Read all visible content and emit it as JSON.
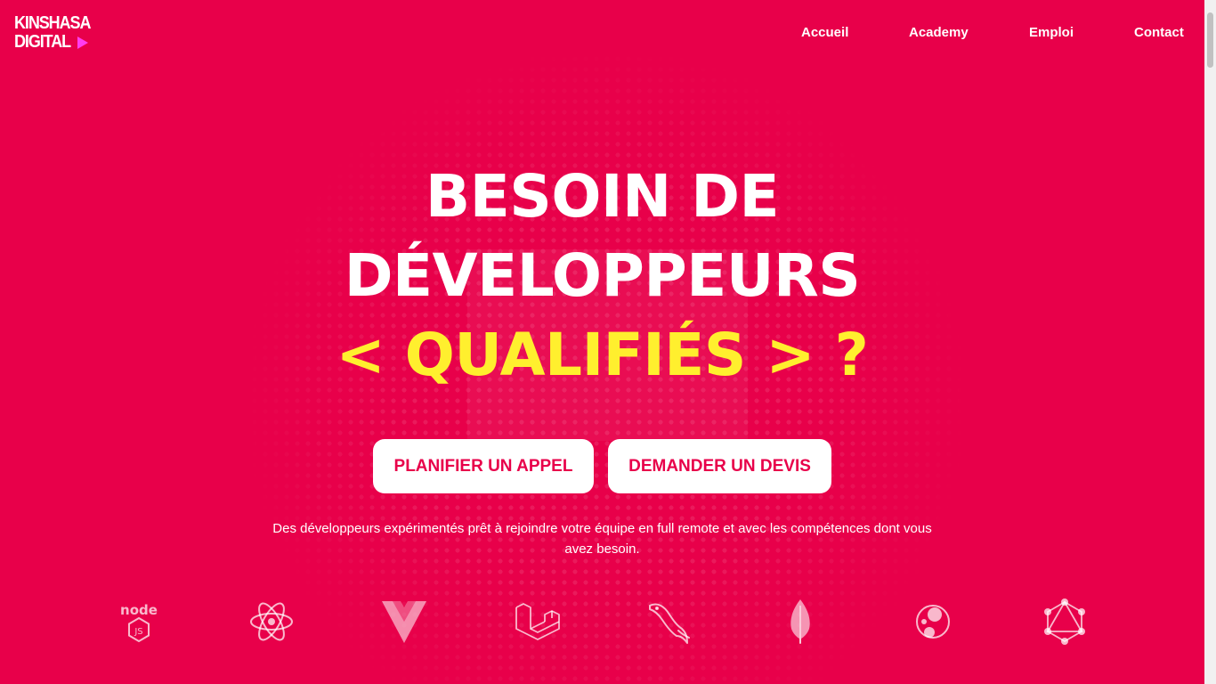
{
  "logo": {
    "line1": "KINSHASA",
    "line2": "DIGITAL"
  },
  "nav": [
    {
      "label": "Accueil"
    },
    {
      "label": "Academy"
    },
    {
      "label": "Emploi"
    },
    {
      "label": "Contact"
    }
  ],
  "hero": {
    "line1": "BESOIN DE",
    "line2": "DÉVELOPPEURS",
    "line3": "< QUALIFIÉS > ?",
    "highlight_color": "#ffef2e"
  },
  "buttons": {
    "call": "PLANIFIER UN APPEL",
    "quote": "DEMANDER UN DEVIS"
  },
  "description": "Des développeurs expérimentés prêt à rejoindre votre équipe en full remote et avec les compétences dont vous avez besoin.",
  "tech_icons": [
    "nodejs-icon",
    "react-icon",
    "vue-icon",
    "laravel-icon",
    "mysql-icon",
    "mongodb-icon",
    "apollo-icon",
    "graphql-icon"
  ],
  "colors": {
    "background": "#e8004a",
    "accent": "#ff3df0",
    "button_text": "#e8004a"
  }
}
